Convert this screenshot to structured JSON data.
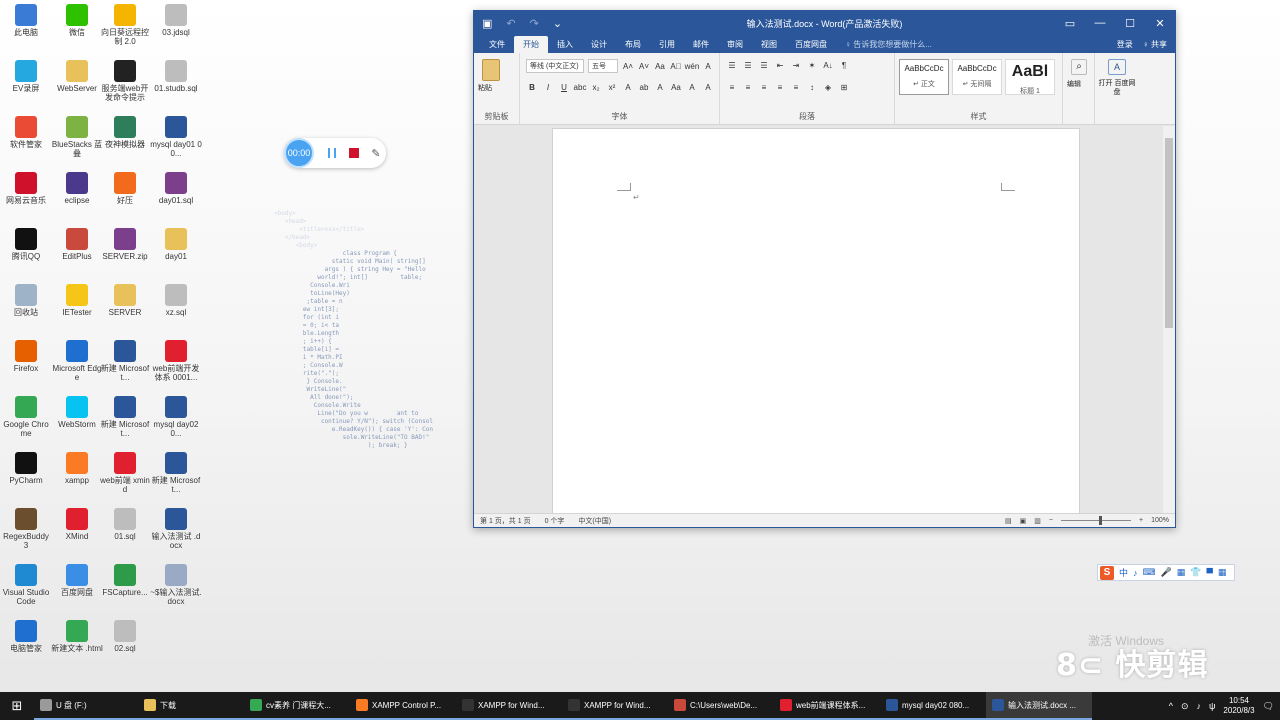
{
  "desktop_icons": [
    {
      "label": "此电脑",
      "icon": "computer-icon",
      "color": "#3a7bd5",
      "col": 0,
      "row": 0
    },
    {
      "label": "微信",
      "icon": "wechat-icon",
      "color": "#2dc100",
      "col": 1,
      "row": 0
    },
    {
      "label": "向日葵远程控制 2.0",
      "icon": "sunflower-icon",
      "color": "#f4b400",
      "col": 2,
      "row": 0
    },
    {
      "label": "03.jdsql",
      "icon": "file-icon",
      "color": "#bdbdbd",
      "col": 3,
      "row": 0
    },
    {
      "label": "EV录屏",
      "icon": "ev-record-icon",
      "color": "#25a8e0",
      "col": 0,
      "row": 1
    },
    {
      "label": "WebServer",
      "icon": "folder-icon",
      "color": "#e8c15a",
      "col": 1,
      "row": 1
    },
    {
      "label": "服务端web开发命令提示",
      "icon": "terminal-icon",
      "color": "#222222",
      "col": 2,
      "row": 1
    },
    {
      "label": "01.studb.sql",
      "icon": "file-icon",
      "color": "#bdbdbd",
      "col": 3,
      "row": 1
    },
    {
      "label": "软件管家",
      "icon": "software-manager-icon",
      "color": "#e94b35",
      "col": 0,
      "row": 2
    },
    {
      "label": "BlueStacks 蓝叠",
      "icon": "bluestacks-icon",
      "color": "#7cb342",
      "col": 1,
      "row": 2
    },
    {
      "label": "夜神模拟器",
      "icon": "nox-icon",
      "color": "#2e7d5b",
      "col": 2,
      "row": 2
    },
    {
      "label": "mysql day01 00...",
      "icon": "word-doc-icon",
      "color": "#2b579a",
      "col": 3,
      "row": 2
    },
    {
      "label": "网易云音乐",
      "icon": "netease-music-icon",
      "color": "#d0112b",
      "col": 0,
      "row": 3
    },
    {
      "label": "eclipse",
      "icon": "eclipse-icon",
      "color": "#4b3a8c",
      "col": 1,
      "row": 3
    },
    {
      "label": "好压",
      "icon": "haozip-icon",
      "color": "#f26b1d",
      "col": 2,
      "row": 3
    },
    {
      "label": "day01.sql",
      "icon": "rar-archive-icon",
      "color": "#7b3f8c",
      "col": 3,
      "row": 3
    },
    {
      "label": "腾讯QQ",
      "icon": "qq-icon",
      "color": "#111111",
      "col": 0,
      "row": 4
    },
    {
      "label": "EditPlus",
      "icon": "editplus-icon",
      "color": "#c94a3c",
      "col": 1,
      "row": 4
    },
    {
      "label": "SERVER.zip",
      "icon": "rar-archive-icon",
      "color": "#7b3f8c",
      "col": 2,
      "row": 4
    },
    {
      "label": "day01",
      "icon": "folder-icon",
      "color": "#e8c15a",
      "col": 3,
      "row": 4
    },
    {
      "label": "回收站",
      "icon": "recycle-bin-icon",
      "color": "#9fb3c8",
      "col": 0,
      "row": 5
    },
    {
      "label": "IETester",
      "icon": "ietester-icon",
      "color": "#f5c518",
      "col": 1,
      "row": 5
    },
    {
      "label": "SERVER",
      "icon": "folder-icon",
      "color": "#e8c15a",
      "col": 2,
      "row": 5
    },
    {
      "label": "xz.sql",
      "icon": "file-icon",
      "color": "#bdbdbd",
      "col": 3,
      "row": 5
    },
    {
      "label": "Firefox",
      "icon": "firefox-icon",
      "color": "#e66000",
      "col": 0,
      "row": 6
    },
    {
      "label": "Microsoft Edge",
      "icon": "edge-icon",
      "color": "#1f6fd1",
      "col": 1,
      "row": 6
    },
    {
      "label": "新建 Microsoft...",
      "icon": "word-doc-icon",
      "color": "#2b579a",
      "col": 2,
      "row": 6
    },
    {
      "label": "web前端开发体系 0001...",
      "icon": "xmind-file-icon",
      "color": "#e0202e",
      "col": 3,
      "row": 6
    },
    {
      "label": "Google Chrome",
      "icon": "chrome-icon",
      "color": "#34a853",
      "col": 0,
      "row": 7
    },
    {
      "label": "WebStorm",
      "icon": "webstorm-icon",
      "color": "#07c3f2",
      "col": 1,
      "row": 7
    },
    {
      "label": "新建 Microsoft...",
      "icon": "word-doc-icon",
      "color": "#2b579a",
      "col": 2,
      "row": 7
    },
    {
      "label": "mysql day02 0...",
      "icon": "word-doc-icon",
      "color": "#2b579a",
      "col": 3,
      "row": 7
    },
    {
      "label": "PyCharm",
      "icon": "pycharm-icon",
      "color": "#111111",
      "col": 0,
      "row": 8
    },
    {
      "label": "xampp",
      "icon": "xampp-icon",
      "color": "#fb7a24",
      "col": 1,
      "row": 8
    },
    {
      "label": "web前端 xmind",
      "icon": "xmind-file-icon",
      "color": "#e0202e",
      "col": 2,
      "row": 8
    },
    {
      "label": "新建 Microsoft...",
      "icon": "word-doc-icon",
      "color": "#2b579a",
      "col": 3,
      "row": 8
    },
    {
      "label": "RegexBuddy 3",
      "icon": "regexbuddy-icon",
      "color": "#6b4e2e",
      "col": 0,
      "row": 9
    },
    {
      "label": "XMind",
      "icon": "xmind-icon",
      "color": "#e0202e",
      "col": 1,
      "row": 9
    },
    {
      "label": "01.sql",
      "icon": "file-icon",
      "color": "#bdbdbd",
      "col": 2,
      "row": 9
    },
    {
      "label": "输入法测试 .docx",
      "icon": "word-doc-icon",
      "color": "#2b579a",
      "col": 3,
      "row": 9
    },
    {
      "label": "Visual Studio Code",
      "icon": "vscode-icon",
      "color": "#1f8ad2",
      "col": 0,
      "row": 10
    },
    {
      "label": "百度网盘",
      "icon": "baidu-netdisk-icon",
      "color": "#3a8ee6",
      "col": 1,
      "row": 10
    },
    {
      "label": "FSCapture...",
      "icon": "fscapture-icon",
      "color": "#2e9b4a",
      "col": 2,
      "row": 10
    },
    {
      "label": "~$输入法测试.docx",
      "icon": "word-doc-icon",
      "color": "#9aa9c4",
      "col": 3,
      "row": 10
    },
    {
      "label": "电脑管家",
      "icon": "pc-manager-icon",
      "color": "#1f6fd1",
      "col": 0,
      "row": 11
    },
    {
      "label": "新建文本 .html",
      "icon": "chrome-icon",
      "color": "#34a853",
      "col": 1,
      "row": 11
    },
    {
      "label": "02.sql",
      "icon": "file-icon",
      "color": "#bdbdbd",
      "col": 2,
      "row": 11
    }
  ],
  "code_art": [
    {
      "text": "<body>",
      "faint": true
    },
    {
      "text": "   <head>",
      "faint": true
    },
    {
      "text": "       <title>xxx</title>",
      "faint": true
    },
    {
      "text": "   </head>",
      "faint": true
    },
    {
      "text": "      <body>",
      "faint": true
    },
    {
      "text": "                   class Program {",
      "faint": false
    },
    {
      "text": "                static void Main( string[]",
      "faint": false
    },
    {
      "text": "              args ) { string Hey = \"Hello",
      "faint": false
    },
    {
      "text": "            world!\"; int[]         table;",
      "faint": false
    },
    {
      "text": "          Console.Wri",
      "faint": false
    },
    {
      "text": "          toLine(Hey)",
      "faint": false
    },
    {
      "text": "         ;table = n",
      "faint": false
    },
    {
      "text": "        ew int[3];",
      "faint": false
    },
    {
      "text": "        for (int i",
      "faint": false
    },
    {
      "text": "        = 0; i< ta",
      "faint": false
    },
    {
      "text": "        ble.Length",
      "faint": false
    },
    {
      "text": "        ; i++) {",
      "faint": false
    },
    {
      "text": "        table[i] =",
      "faint": false
    },
    {
      "text": "        i * Math.PI",
      "faint": false
    },
    {
      "text": "        ; Console.W",
      "faint": false
    },
    {
      "text": "        rite(\".\");",
      "faint": false
    },
    {
      "text": "         } Console.",
      "faint": false
    },
    {
      "text": "         WriteLine(\"",
      "faint": false
    },
    {
      "text": "          All done!\");",
      "faint": false
    },
    {
      "text": "           Console.Write",
      "faint": false
    },
    {
      "text": "            Line(\"Do you w        ant to",
      "faint": false
    },
    {
      "text": "             continue? Y/N\"); switch (Consol",
      "faint": false
    },
    {
      "text": "                e.ReadKey()) { case 'Y': Con",
      "faint": false
    },
    {
      "text": "                   sole.WriteLine(\"TO BAD!\"",
      "faint": false
    },
    {
      "text": "                          ); break; }",
      "faint": false
    }
  ],
  "recorder": {
    "time": "00:00",
    "pause_icon": "pause-icon",
    "stop_icon": "stop-icon",
    "pen_glyph": "✎"
  },
  "word": {
    "qat": {
      "save": "▣",
      "undo": "↶",
      "redo": "↷",
      "customize": "⌄"
    },
    "title": "输入法测试.docx - Word(产品激活失败)",
    "window_controls": {
      "ribbon_display": "▭",
      "minimize": "—",
      "maximize": "☐",
      "close": "✕"
    },
    "tabs": [
      {
        "label": "文件",
        "active": false
      },
      {
        "label": "开始",
        "active": true
      },
      {
        "label": "插入",
        "active": false
      },
      {
        "label": "设计",
        "active": false
      },
      {
        "label": "布局",
        "active": false
      },
      {
        "label": "引用",
        "active": false
      },
      {
        "label": "邮件",
        "active": false
      },
      {
        "label": "审阅",
        "active": false
      },
      {
        "label": "视图",
        "active": false
      },
      {
        "label": "百度网盘",
        "active": false
      }
    ],
    "tell_me": "♀ 告诉我您想要做什么...",
    "sign_in": "登录",
    "share": "♀ 共享",
    "ribbon": {
      "clipboard": {
        "paste": "粘贴",
        "group": "剪贴板"
      },
      "font": {
        "font_name": "等线 (中文正文)",
        "font_size": "五号",
        "row1_tools": [
          "A˄",
          "A˅",
          "Aa",
          "A⃠",
          "wén",
          "A"
        ],
        "row2_tools": [
          "B",
          "I",
          "U",
          "abc",
          "x₂",
          "x²",
          "A",
          "ab",
          "A",
          "Aa",
          "A",
          "A"
        ],
        "group": "字体"
      },
      "paragraph": {
        "row1_tools": [
          "☰",
          "☰",
          "☰",
          "⇤",
          "⇥",
          "✶",
          "A↓",
          "¶"
        ],
        "row2_tools": [
          "≡",
          "≡",
          "≡",
          "≡",
          "≡",
          "↕",
          "◈",
          "⊞"
        ],
        "group": "段落"
      },
      "styles": {
        "items": [
          {
            "sample": "AaBbCcDc",
            "name": "↵ 正文",
            "big": false,
            "selected": true
          },
          {
            "sample": "AaBbCcDc",
            "name": "↵ 无间隔",
            "big": false,
            "selected": false
          },
          {
            "sample": "AaBl",
            "name": "标题 1",
            "big": true,
            "selected": false
          }
        ],
        "group": "样式"
      },
      "editing": {
        "label": "编辑",
        "icon": "search-icon"
      },
      "voice": {
        "label": "打开 百度网盘",
        "icon": "baidu-cloud-icon"
      }
    },
    "doc": {
      "pilcrow": "↵"
    },
    "status": {
      "page": "第 1 页，共 1 页",
      "words": "0 个字",
      "language": "中文(中国)",
      "zoom": "100%",
      "zoom_minus": "−",
      "zoom_plus": "+"
    }
  },
  "ime": {
    "logo": "S",
    "items": [
      "中",
      "♪",
      "⌨",
      "🎤",
      "▦",
      "👕",
      "▀",
      "▦"
    ]
  },
  "watermark_activate": "激活 Windows",
  "watermark_brand": "8⊂ 快剪辑",
  "taskbar": {
    "start": "⊞",
    "items": [
      {
        "label": "U 盘 (F:)",
        "icon": "usb-drive-icon",
        "color": "#9a9a9a",
        "open": true,
        "active": false
      },
      {
        "label": "下载",
        "icon": "folder-icon",
        "color": "#e8c15a",
        "open": true,
        "active": false
      },
      {
        "label": "cv素养 门课程大...",
        "icon": "chrome-icon",
        "color": "#34a853",
        "open": true,
        "active": false
      },
      {
        "label": "XAMPP Control P...",
        "icon": "xampp-icon",
        "color": "#fb7a24",
        "open": true,
        "active": false
      },
      {
        "label": "XAMPP for Wind...",
        "icon": "terminal-icon",
        "color": "#333333",
        "open": true,
        "active": false
      },
      {
        "label": "XAMPP for Wind...",
        "icon": "terminal-icon",
        "color": "#333333",
        "open": true,
        "active": false
      },
      {
        "label": "C:\\Users\\web\\De...",
        "icon": "editplus-icon",
        "color": "#c94a3c",
        "open": true,
        "active": false
      },
      {
        "label": "web前端课程体系...",
        "icon": "xmind-icon",
        "color": "#e0202e",
        "open": true,
        "active": false
      },
      {
        "label": "mysql day02 080...",
        "icon": "word-icon",
        "color": "#2b579a",
        "open": true,
        "active": false
      },
      {
        "label": "输入法测试.docx ...",
        "icon": "word-icon",
        "color": "#2b579a",
        "open": true,
        "active": true
      }
    ],
    "tray": {
      "chevron": "^",
      "network": "⊙",
      "volume": "♪",
      "lang": "ψ",
      "time": "10:54",
      "date": "2020/8/3",
      "notify": "🗨"
    }
  }
}
